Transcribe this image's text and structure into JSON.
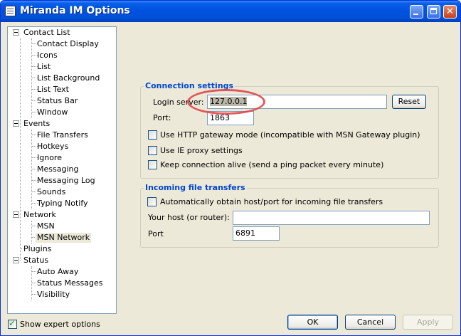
{
  "window": {
    "title": "Miranda IM Options"
  },
  "tree": {
    "nodes": [
      {
        "label": "Contact List"
      },
      {
        "label": "Contact Display"
      },
      {
        "label": "Icons"
      },
      {
        "label": "List"
      },
      {
        "label": "List Background"
      },
      {
        "label": "List Text"
      },
      {
        "label": "Status Bar"
      },
      {
        "label": "Window"
      },
      {
        "label": "Events"
      },
      {
        "label": "File Transfers"
      },
      {
        "label": "Hotkeys"
      },
      {
        "label": "Ignore"
      },
      {
        "label": "Messaging"
      },
      {
        "label": "Messaging Log"
      },
      {
        "label": "Sounds"
      },
      {
        "label": "Typing Notify"
      },
      {
        "label": "Network"
      },
      {
        "label": "MSN"
      },
      {
        "label": "MSN Network"
      },
      {
        "label": "Plugins"
      },
      {
        "label": "Status"
      },
      {
        "label": "Auto Away"
      },
      {
        "label": "Status Messages"
      },
      {
        "label": "Visibility"
      }
    ],
    "selected": "MSN Network"
  },
  "connection": {
    "title": "Connection settings",
    "login_server_label": "Login server:",
    "login_server_value": "127.0.0.1",
    "reset_label": "Reset",
    "port_label": "Port:",
    "port_value": "1863",
    "http_gateway_label": "Use HTTP gateway mode (incompatible with MSN Gateway plugin)",
    "ie_proxy_label": "Use IE proxy settings",
    "keep_alive_label": "Keep connection alive (send a ping packet every minute)"
  },
  "incoming": {
    "title": "Incoming file transfers",
    "auto_obtain_label": "Automatically obtain host/port for incoming file transfers",
    "your_host_label": "Your host (or router):",
    "your_host_value": "",
    "port_label": "Port",
    "port_value": "6891"
  },
  "footer": {
    "expert_label": "Show expert options",
    "expert_checked": true,
    "ok_label": "OK",
    "cancel_label": "Cancel",
    "apply_label": "Apply"
  }
}
